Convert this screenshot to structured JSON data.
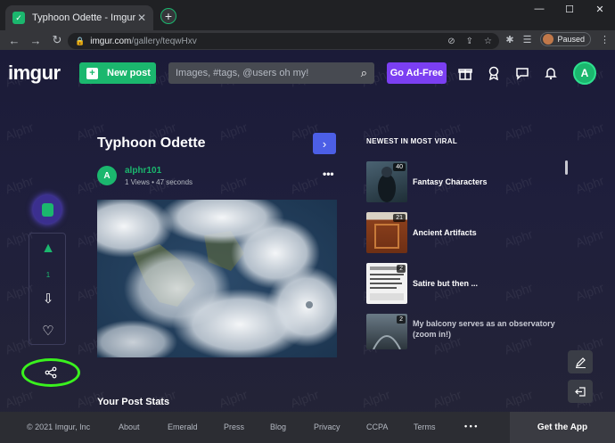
{
  "browser": {
    "tab_title": "Typhoon Odette - Imgur",
    "url_domain": "imgur.com",
    "url_path": "/gallery/teqwHxv",
    "profile_status": "Paused"
  },
  "header": {
    "logo": "imgur",
    "new_post_label": "New post",
    "search_placeholder": "Images, #tags, @users oh my!",
    "ad_free_label": "Go Ad-Free",
    "avatar_initial": "A"
  },
  "sidebar": {
    "vote_count": "1"
  },
  "post": {
    "title": "Typhoon Odette",
    "author": "alphr101",
    "author_initial": "A",
    "meta": "1 Views • 47 seconds",
    "stats_heading": "Your Post Stats"
  },
  "viral": {
    "heading": "NEWEST IN MOST VIRAL",
    "items": [
      {
        "label": "Fantasy Characters",
        "badge": "40"
      },
      {
        "label": "Ancient Artifacts",
        "badge": "21"
      },
      {
        "label": "Satire but then ...",
        "badge": "2"
      },
      {
        "label": "My balcony serves as an observatory (zoom in!)",
        "badge": "2"
      }
    ]
  },
  "footer": {
    "copyright": "© 2021 Imgur, Inc",
    "links": [
      "About",
      "Emerald",
      "Press",
      "Blog",
      "Privacy",
      "CCPA",
      "Terms"
    ],
    "more": "• • •",
    "get_app": "Get the App"
  },
  "colors": {
    "brand_green": "#1bb76e",
    "ad_free_purple": "#7b3ff2",
    "next_blue": "#4c5fe6",
    "highlight_ring": "#3af21e"
  },
  "icons": [
    "search-icon",
    "gift-icon",
    "award-icon",
    "chat-icon",
    "bell-icon",
    "upvote-icon",
    "downvote-icon",
    "heart-icon",
    "share-icon",
    "edit-icon",
    "logout-icon"
  ]
}
